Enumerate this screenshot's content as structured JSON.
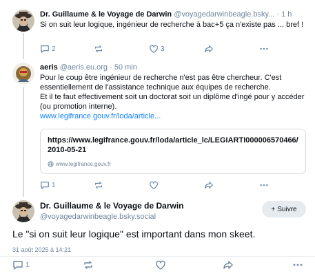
{
  "post1": {
    "author_name": "Dr. Guillaume & le Voyage de Darwin",
    "author_handle": "@voyagedarwinbeagle.bsky...",
    "time": "1 h",
    "text": "Si on suit leur logique, ingénieur de recherche à bac+5 ça n'existe pas ... bref !",
    "reply_count": "2",
    "like_count": "3"
  },
  "post2": {
    "author_name": "aeris",
    "author_handle": "@aeris.eu.org",
    "time": "50 min",
    "text_lines": [
      "Pour le coup être ingénieur de recherche n'est pas être chercheur. C'est essentiellement de l'assistance technique aux équipes de recherche.",
      "Et il te faut effectivement soit un doctorat soit un diplôme d'ingé pour y accéder (ou promotion interne)."
    ],
    "link_text": "www.legifrance.gouv.fr/loda/article...",
    "card": {
      "title": "https://www.legifrance.gouv.fr/loda/article_lc/LEGIARTI000006570466/2010-05-21",
      "domain": "www.legifrance.gouv.fr"
    },
    "reply_count": "1"
  },
  "main_post": {
    "author_name": "Dr. Guillaume & le Voyage de Darwin",
    "author_handle": "@voyagedarwinbeagle.bsky.social",
    "follow_label": "Suivre",
    "text": "Le \"si on suit leur logique\" est important dans mon skeet.",
    "date": "31 août 2025 à 14:21",
    "reply_count": "1"
  },
  "colors": {
    "text": "#0b0f14",
    "muted": "#6f869f",
    "link": "#1083fe",
    "border": "#d4dbe2",
    "button_bg": "#e6ebef"
  },
  "icons": [
    "reply-icon",
    "repost-icon",
    "like-icon",
    "share-icon",
    "more-icon",
    "globe-icon",
    "plus-icon"
  ]
}
